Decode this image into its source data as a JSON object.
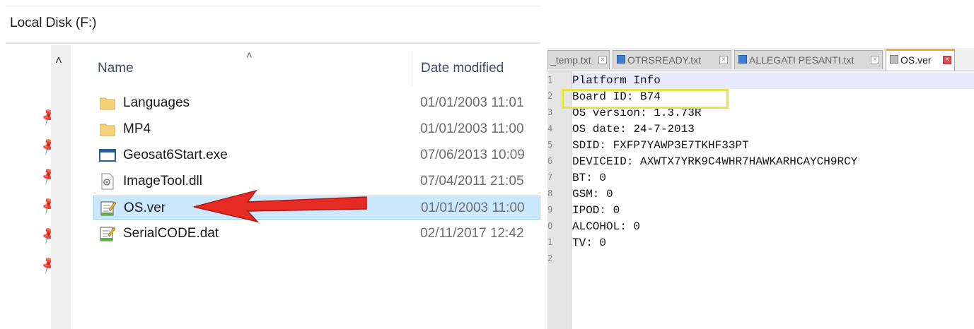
{
  "explorer": {
    "breadcrumb": "Local Disk (F:)",
    "columns": {
      "name": "Name",
      "date": "Date modified"
    },
    "files": [
      {
        "name": "Languages",
        "date": "01/01/2003 11:01",
        "icon": "folder-icon"
      },
      {
        "name": "MP4",
        "date": "01/01/2003 11:00",
        "icon": "folder-icon"
      },
      {
        "name": "Geosat6Start.exe",
        "date": "07/06/2013 10:09",
        "icon": "exe-icon"
      },
      {
        "name": "ImageTool.dll",
        "date": "07/04/2011 21:05",
        "icon": "dll-icon"
      },
      {
        "name": "OS.ver",
        "date": "01/01/2003 11:00",
        "icon": "text-file-icon",
        "selected": true
      },
      {
        "name": "SerialCODE.dat",
        "date": "02/11/2017 12:42",
        "icon": "text-file-icon"
      }
    ]
  },
  "editor": {
    "tabs": [
      {
        "label": "_temp.txt",
        "icon": ""
      },
      {
        "label": "OTRSREADY.txt",
        "icon": "save-icon"
      },
      {
        "label": "ALLEGATI PESANTI.txt",
        "icon": "save-icon"
      },
      {
        "label": "OS.ver",
        "icon": "save-icon-gray",
        "active": true
      }
    ],
    "line_numbers": [
      "1",
      "2",
      "3",
      "4",
      "5",
      "6",
      "7",
      "8",
      "9",
      "0",
      "1",
      "2"
    ],
    "lines": [
      "Platform Info",
      "Board ID: B74",
      "OS version: 1.3.73R",
      "OS date: 24-7-2013",
      "SDID: FXFP7YAWP3E7TKHF33PT",
      "DEVICEID: AXWTX7YRK9C4WHR7HAWKARHCAYCH9RCY",
      "BT: 0",
      "GSM: 0",
      "IPOD: 0",
      "ALCOHOL: 0",
      "TV: 0",
      ""
    ]
  },
  "colors": {
    "selection": "#cce8ff",
    "arrow": "#e52b24",
    "highlight": "#e6e640",
    "active_tab_accent": "#f4a83a"
  }
}
